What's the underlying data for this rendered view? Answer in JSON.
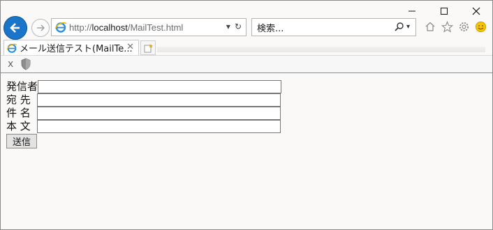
{
  "window": {
    "controls": {
      "minimize_icon": "minimize-icon",
      "maximize_icon": "maximize-icon",
      "close_icon": "close-icon"
    }
  },
  "navbar": {
    "url_prefix": "http://",
    "url_host": "localhost",
    "url_path": "/MailTest.html",
    "search_placeholder": "検索...",
    "addr_icons": [
      "dropdown-icon",
      "refresh-icon"
    ],
    "toolbar_icons": [
      "home-icon",
      "favorites-star-icon",
      "settings-gear-icon",
      "smiley-feedback-icon"
    ]
  },
  "tabs": [
    {
      "title": "メール送信テスト(MailTe...",
      "close": "✕",
      "active": true
    }
  ],
  "cmdbar": {
    "close": "x"
  },
  "form": {
    "sender_label": "発信者",
    "to_label": "宛 先",
    "subject_label": "件 名",
    "body_label": "本 文",
    "sender_value": "",
    "to_value": "",
    "subject_value": "",
    "body_value": "",
    "send_label": "送信"
  },
  "colors": {
    "accent": "#1a75c9",
    "content_bg": "#faf9f8"
  }
}
